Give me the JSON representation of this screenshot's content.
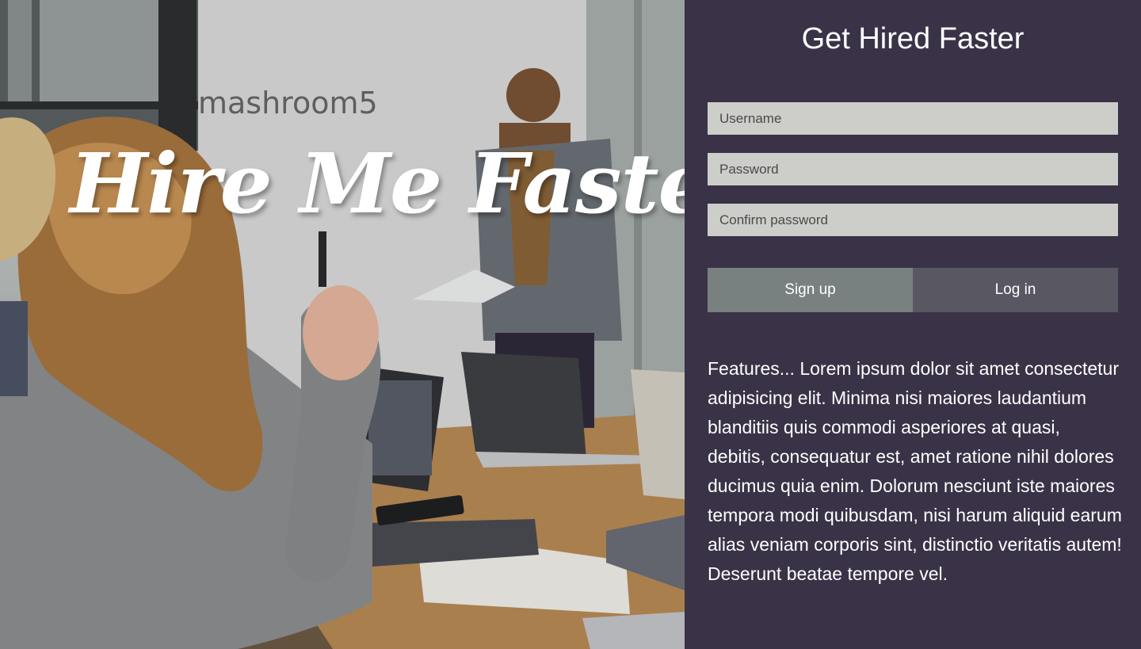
{
  "hero": {
    "title": "Hire Me Faster",
    "wall_sign": "mashroom5"
  },
  "panel": {
    "title": "Get Hired Faster",
    "username_placeholder": "Username",
    "password_placeholder": "Password",
    "confirm_placeholder": "Confirm password",
    "signup_label": "Sign up",
    "login_label": "Log in",
    "features_text": "Features... Lorem ipsum dolor sit amet consectetur adipisicing elit. Minima nisi maiores laudantium blanditiis quis commodi asperiores at quasi, debitis, consequatur est, amet ratione nihil dolores ducimus quia enim. Dolorum nesciunt iste maiores tempora modi quibusdam, nisi harum aliquid earum alias veniam corporis sint, distinctio veritatis autem! Deserunt beatae tempore vel."
  },
  "colors": {
    "panel_bg": "#3a3347",
    "input_bg": "#cdcdca",
    "signup_bg": "#78817f",
    "login_bg": "#595761"
  }
}
